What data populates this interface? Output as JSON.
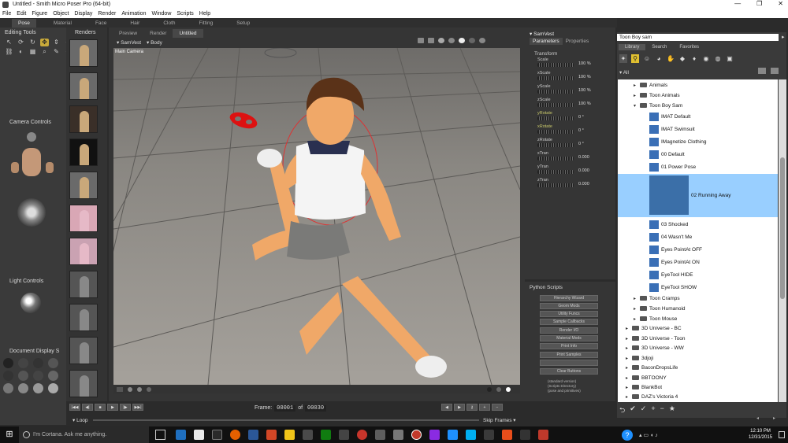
{
  "window": {
    "title": "Untitled - Smith Micro Poser Pro (64-bit)",
    "controls": [
      "—",
      "❐",
      "✕"
    ]
  },
  "menu": [
    "File",
    "Edit",
    "Figure",
    "Object",
    "Display",
    "Render",
    "Animation",
    "Window",
    "Scripts",
    "Help"
  ],
  "room_tabs": [
    "Pose",
    "Material",
    "Face",
    "Hair",
    "Cloth",
    "Fitting",
    "Setup"
  ],
  "left": {
    "editing_tools": "Editing Tools",
    "renders": "Renders",
    "camera_controls": "Camera Controls",
    "light_controls": "Light Controls",
    "document_display": "Document Display S"
  },
  "viewport": {
    "tabs": [
      "Preview",
      "Render",
      "Untitled"
    ],
    "figure_menu": "SamVest",
    "actor_menu": "Body",
    "camera_label": "Main Camera"
  },
  "params": {
    "actor": "SamVest",
    "tabs": [
      "Parameters",
      "Properties"
    ],
    "section": "Transform",
    "rows": [
      {
        "label": "Scale",
        "value": "100 %",
        "highlight": true
      },
      {
        "label": "xScale",
        "value": "100 %",
        "highlight": false
      },
      {
        "label": "yScale",
        "value": "100 %",
        "highlight": false
      },
      {
        "label": "zScale",
        "value": "100 %",
        "highlight": false
      },
      {
        "label": "yRotate",
        "value": "0 °",
        "highlight": true
      },
      {
        "label": "xRotate",
        "value": "0 °",
        "highlight": true
      },
      {
        "label": "zRotate",
        "value": "0 °",
        "highlight": false
      },
      {
        "label": "xTran",
        "value": "0.000",
        "highlight": false
      },
      {
        "label": "yTran",
        "value": "0.000",
        "highlight": false
      },
      {
        "label": "zTran",
        "value": "0.000",
        "highlight": false
      }
    ]
  },
  "python": {
    "title": "Python Scripts",
    "buttons": [
      "Hierarchy Wizard",
      "Geom Mods",
      "Utility Funcs",
      "Sample Callbacks",
      "Render I/O",
      "Material Mods",
      "Print Info",
      "Print Samples",
      "",
      "Clear Buttons"
    ],
    "footer": [
      "(standard version)",
      "(Scripts Directory)",
      "(pose and primitives)"
    ]
  },
  "library": {
    "search": "Toon Boy sam",
    "tabs": [
      "Library",
      "Search",
      "Favorites"
    ],
    "root": "All",
    "items": [
      {
        "label": "Animals",
        "type": "folder",
        "indent": 2,
        "expanded": false
      },
      {
        "label": "Toon Animals",
        "type": "folder",
        "indent": 2,
        "expanded": false
      },
      {
        "label": "Toon Boy Sam",
        "type": "folder",
        "indent": 2,
        "expanded": true
      },
      {
        "label": "IMAT Default",
        "type": "file",
        "indent": 3
      },
      {
        "label": "IMAT Swimsuit",
        "type": "file",
        "indent": 3
      },
      {
        "label": "IMagnetize Clothing",
        "type": "file",
        "indent": 3
      },
      {
        "label": "00 Default",
        "type": "file",
        "indent": 3
      },
      {
        "label": "01 Power Pose",
        "type": "file",
        "indent": 3
      },
      {
        "label": "02 Running Away",
        "type": "file",
        "indent": 3,
        "selected": true
      },
      {
        "label": "03 Shocked",
        "type": "file",
        "indent": 3
      },
      {
        "label": "04 Wasn't Me",
        "type": "file",
        "indent": 3
      },
      {
        "label": "Eyes PointAt OFF",
        "type": "file",
        "indent": 3
      },
      {
        "label": "Eyes PointAt ON",
        "type": "file",
        "indent": 3
      },
      {
        "label": "EyeTool HIDE",
        "type": "file",
        "indent": 3
      },
      {
        "label": "EyeTool SHOW",
        "type": "file",
        "indent": 3
      },
      {
        "label": "Toon Cramps",
        "type": "folder",
        "indent": 2,
        "expanded": false
      },
      {
        "label": "Toon Humanoid",
        "type": "folder",
        "indent": 2,
        "expanded": false
      },
      {
        "label": "Toon Mouse",
        "type": "folder",
        "indent": 2,
        "expanded": false
      },
      {
        "label": "3D Universe - BC",
        "type": "folder",
        "indent": 1,
        "expanded": false
      },
      {
        "label": "3D Universe - Toon",
        "type": "folder",
        "indent": 1,
        "expanded": false
      },
      {
        "label": "3D Universe - WW",
        "type": "folder",
        "indent": 1,
        "expanded": false
      },
      {
        "label": "3djoji",
        "type": "folder",
        "indent": 1,
        "expanded": false
      },
      {
        "label": "BaconDropsLife",
        "type": "folder",
        "indent": 1,
        "expanded": false
      },
      {
        "label": "BBTOONY",
        "type": "folder",
        "indent": 1,
        "expanded": false
      },
      {
        "label": "BlankBot",
        "type": "folder",
        "indent": 1,
        "expanded": false
      },
      {
        "label": "DAZ's Victoria 4",
        "type": "folder",
        "indent": 1,
        "expanded": false
      }
    ]
  },
  "timeline": {
    "frame_label": "Frame:",
    "frame": "00001",
    "of_label": "of",
    "total": "00030",
    "loop": "Loop",
    "skip": "Skip Frames"
  },
  "taskbar": {
    "search": "I'm Cortana. Ask me anything.",
    "time": "12:10 PM",
    "date": "12/31/2015",
    "icon_colors": [
      "#3b78e7",
      "#1f6fbf",
      "#e8e8e8",
      "#222222",
      "#e66000",
      "#2b5797",
      "#d24726",
      "#f0c419",
      "#4a4a4a",
      "#107c10",
      "#444444",
      "#c7352b",
      "#5e5e5e",
      "#777777",
      "#8a2be2",
      "#1e90ff",
      "#00aff0",
      "#3a3a3a",
      "#e94e1b",
      "#333333",
      "#c0392b"
    ]
  },
  "colors": {
    "selection": "#99cfff",
    "tool_active": "#c8a93a",
    "param_highlight": "#c8c86a"
  }
}
